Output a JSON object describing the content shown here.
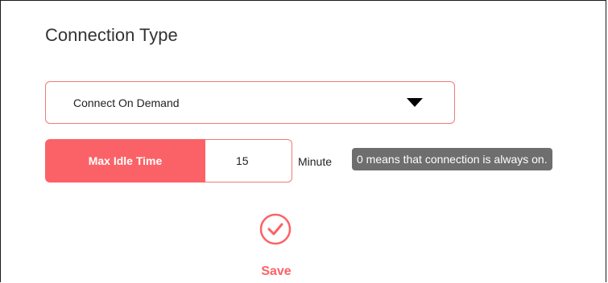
{
  "section": {
    "title": "Connection Type"
  },
  "connection_type": {
    "selected": "Connect On Demand"
  },
  "max_idle_time": {
    "label": "Max Idle Time",
    "value": "15",
    "unit": "Minute",
    "hint": "0 means that connection is always on."
  },
  "actions": {
    "save_label": "Save"
  },
  "colors": {
    "accent": "#fb6267",
    "border": "#ee7b7b",
    "tooltip_bg": "#6e6e6e"
  },
  "icons": {
    "dropdown": "caret-down-icon",
    "save": "checkmark-circle-icon"
  }
}
